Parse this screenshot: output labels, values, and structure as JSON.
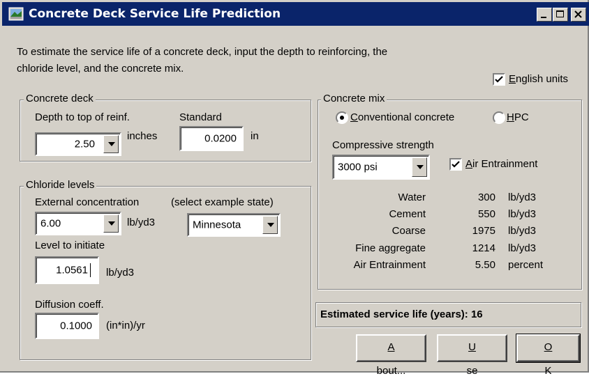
{
  "window": {
    "title": "Concrete Deck Service Life Prediction"
  },
  "intro_lines": [
    "To estimate the service life of a concrete deck, input the depth to reinforcing, the",
    "chloride level, and the concrete mix."
  ],
  "english_units": {
    "label_u": "E",
    "label_rest": "nglish units",
    "checked": true
  },
  "deck": {
    "legend": "Concrete deck",
    "depth_label": "Depth to top of reinf.",
    "depth_value": "2.50",
    "depth_unit": "inches",
    "standard_label": "Standard",
    "standard_value": "0.0200",
    "standard_unit": "in"
  },
  "chloride": {
    "legend": "Chloride levels",
    "external_label": "External concentration",
    "state_label": "(select example state)",
    "external_value": "6.00",
    "external_unit": "lb/yd3",
    "state_value": "Minnesota",
    "initiate_label": "Level to initiate",
    "initiate_value": "1.0561",
    "initiate_unit": "lb/yd3",
    "diffusion_label": "Diffusion coeff.",
    "diffusion_value": "0.1000",
    "diffusion_unit": "(in*in)/yr"
  },
  "mix": {
    "legend": "Concrete mix",
    "conventional_u": "C",
    "conventional_rest": "onventional concrete",
    "hpc_pre": "",
    "hpc_u": "H",
    "hpc_rest": "PC",
    "selected": "conventional",
    "strength_label": "Compressive strength",
    "strength_value": "3000 psi",
    "air_u": "A",
    "air_rest": "ir Entrainment",
    "air_checked": true,
    "rows": [
      {
        "name": "Water",
        "value": "300",
        "unit": "lb/yd3"
      },
      {
        "name": "Cement",
        "value": "550",
        "unit": "lb/yd3"
      },
      {
        "name": "Coarse",
        "value": "1975",
        "unit": "lb/yd3"
      },
      {
        "name": "Fine aggregate",
        "value": "1214",
        "unit": "lb/yd3"
      },
      {
        "name": "Air Entrainment",
        "value": "5.50",
        "unit": "percent"
      }
    ]
  },
  "result": {
    "text": "Estimated service life (years): 16"
  },
  "buttons": {
    "about_u": "A",
    "about_rest": "bout...",
    "use_u": "U",
    "use_rest": "se",
    "ok_u": "O",
    "ok_rest": "K"
  },
  "colors": {
    "titlebar": "#0a246a",
    "face": "#d4d0c8",
    "shadow": "#808080"
  },
  "icons": [
    "app-icon",
    "minimize-icon",
    "maximize-icon",
    "close-icon",
    "dropdown-arrow-icon",
    "checkmark-icon"
  ]
}
